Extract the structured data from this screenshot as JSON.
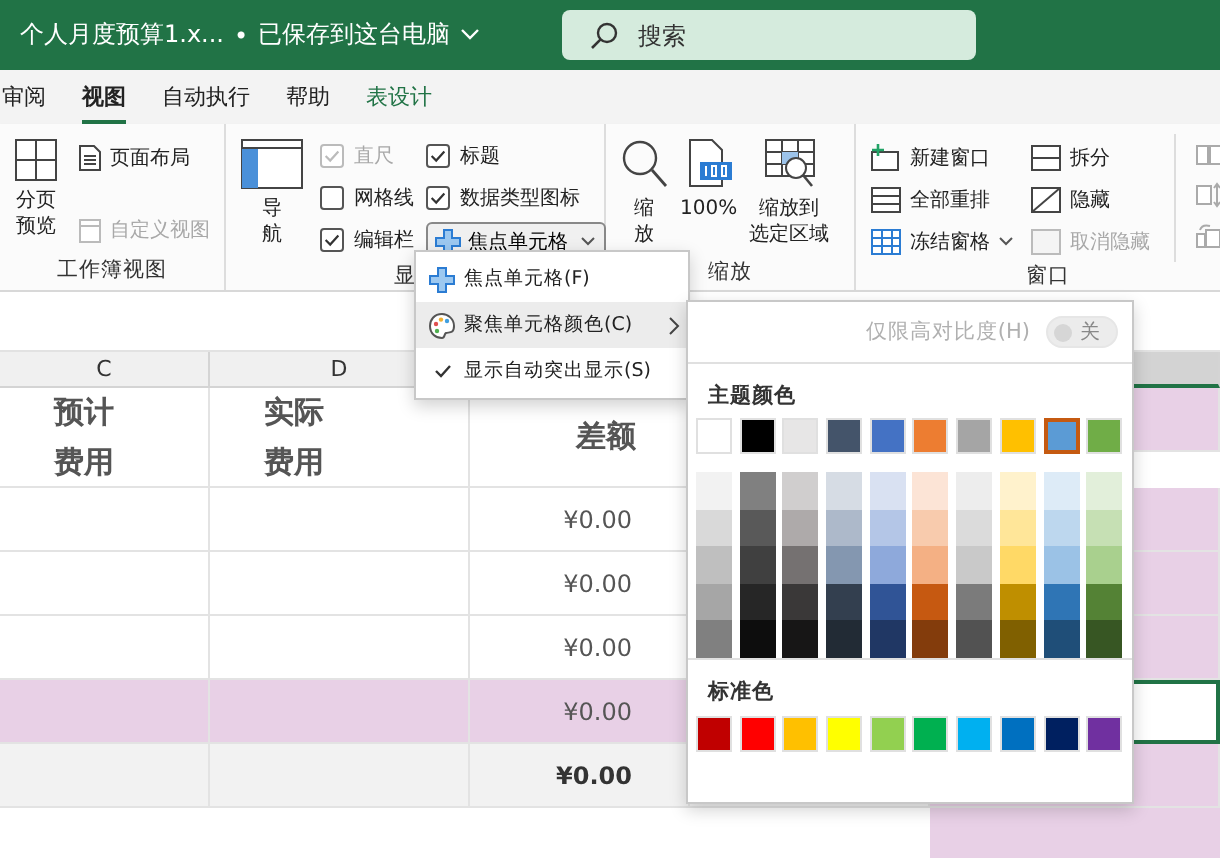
{
  "title_bar": {
    "document": "个人月度预算1.x...",
    "separator": "•",
    "save_status": "已保存到这台电脑",
    "search": {
      "placeholder": "搜索"
    }
  },
  "tabs": [
    {
      "label": "审阅",
      "selected": false,
      "kind": "normal"
    },
    {
      "label": "视图",
      "selected": true,
      "kind": "normal"
    },
    {
      "label": "自动执行",
      "selected": false,
      "kind": "normal"
    },
    {
      "label": "帮助",
      "selected": false,
      "kind": "normal"
    },
    {
      "label": "表设计",
      "selected": false,
      "kind": "contextual"
    }
  ],
  "ribbon": [
    {
      "label": "工作簿视图",
      "buttons": [
        {
          "label": "分页预览",
          "disabled": false
        },
        {
          "label": "页面布局",
          "disabled": false
        },
        {
          "label": "自定义视图",
          "disabled": true
        }
      ]
    },
    {
      "label": "显",
      "buttons": [
        {
          "label": "导航",
          "disabled": false
        }
      ],
      "checkboxes": [
        {
          "label": "直尺",
          "checked": true,
          "disabled": true
        },
        {
          "label": "网格线",
          "checked": false,
          "disabled": false
        },
        {
          "label": "编辑栏",
          "checked": true,
          "disabled": false
        },
        {
          "label": "标题",
          "checked": true,
          "disabled": false
        },
        {
          "label": "数据类型图标",
          "checked": true,
          "disabled": false
        }
      ],
      "dropdown": {
        "label": "焦点单元格",
        "expanded": true
      }
    },
    {
      "label": "缩放",
      "buttons": [
        {
          "label": "缩放",
          "disabled": false
        },
        {
          "label": "100%",
          "disabled": false
        },
        {
          "label": "缩放到选定区域",
          "disabled": false
        }
      ]
    },
    {
      "label": "窗口",
      "buttons": [
        {
          "label": "新建窗口",
          "disabled": false
        },
        {
          "label": "全部重排",
          "disabled": false
        },
        {
          "label": "冻结窗格",
          "disabled": false
        },
        {
          "label": "拆分",
          "disabled": false
        },
        {
          "label": "隐藏",
          "disabled": false
        },
        {
          "label": "取消隐藏",
          "disabled": true
        }
      ]
    }
  ],
  "sheet": {
    "columns": [
      "C",
      "D"
    ],
    "rows": [
      {
        "kind": "header",
        "c": "预计费用",
        "d": "实际费用",
        "e": "差额"
      },
      {
        "kind": "data",
        "e": "¥0.00"
      },
      {
        "kind": "data",
        "e": "¥0.00"
      },
      {
        "kind": "data",
        "e": "¥0.00"
      },
      {
        "kind": "focus",
        "e": "¥0.00"
      },
      {
        "kind": "total",
        "e": "¥0.00"
      }
    ]
  },
  "focus_menu": [
    {
      "label": "焦点单元格(F)",
      "kind": "command"
    },
    {
      "label": "聚焦单元格颜色(C)",
      "kind": "submenu",
      "expanded": true
    },
    {
      "label": "显示自动突出显示(S)",
      "kind": "toggle",
      "checked": true
    }
  ],
  "color_menu": {
    "high_contrast": {
      "label": "仅限高对比度(H)",
      "on": false,
      "disabled": true,
      "state_text": "关"
    },
    "theme_title": "主题颜色",
    "theme_colors": [
      {
        "color": "#ffffff",
        "selected": false,
        "shades": [
          {
            "color": "#f2f2f2"
          },
          {
            "color": "#d9d9d9"
          },
          {
            "color": "#bfbfbf"
          },
          {
            "color": "#a6a6a6"
          },
          {
            "color": "#808080"
          }
        ]
      },
      {
        "color": "#000000",
        "selected": false,
        "shades": [
          {
            "color": "#808080"
          },
          {
            "color": "#595959"
          },
          {
            "color": "#404040"
          },
          {
            "color": "#262626"
          },
          {
            "color": "#0d0d0d"
          }
        ]
      },
      {
        "color": "#e7e6e6",
        "selected": false,
        "shades": [
          {
            "color": "#d0cece"
          },
          {
            "color": "#aeaaaa"
          },
          {
            "color": "#757171"
          },
          {
            "color": "#3a3838"
          },
          {
            "color": "#171616"
          }
        ]
      },
      {
        "color": "#44546a",
        "selected": false,
        "shades": [
          {
            "color": "#d6dce4"
          },
          {
            "color": "#adb9ca"
          },
          {
            "color": "#8497b0"
          },
          {
            "color": "#333f4f"
          },
          {
            "color": "#222b35"
          }
        ]
      },
      {
        "color": "#4472c4",
        "selected": false,
        "shades": [
          {
            "color": "#d9e1f2"
          },
          {
            "color": "#b4c6e7"
          },
          {
            "color": "#8ea9db"
          },
          {
            "color": "#305496"
          },
          {
            "color": "#203764"
          }
        ]
      },
      {
        "color": "#ed7d31",
        "selected": false,
        "shades": [
          {
            "color": "#fce4d6"
          },
          {
            "color": "#f8cbad"
          },
          {
            "color": "#f4b084"
          },
          {
            "color": "#c65911"
          },
          {
            "color": "#833c0c"
          }
        ]
      },
      {
        "color": "#a5a5a5",
        "selected": false,
        "shades": [
          {
            "color": "#ededed"
          },
          {
            "color": "#dbdbdb"
          },
          {
            "color": "#c9c9c9"
          },
          {
            "color": "#7b7b7b"
          },
          {
            "color": "#525252"
          }
        ]
      },
      {
        "color": "#ffc000",
        "selected": false,
        "shades": [
          {
            "color": "#fff2cc"
          },
          {
            "color": "#ffe699"
          },
          {
            "color": "#ffd966"
          },
          {
            "color": "#bf8f00"
          },
          {
            "color": "#806000"
          }
        ]
      },
      {
        "color": "#5b9bd5",
        "selected": true,
        "shades": [
          {
            "color": "#ddebf7"
          },
          {
            "color": "#bdd7ee"
          },
          {
            "color": "#9bc2e6"
          },
          {
            "color": "#2f75b5"
          },
          {
            "color": "#1f4e78"
          }
        ]
      },
      {
        "color": "#70ad47",
        "selected": false,
        "shades": [
          {
            "color": "#e2efda"
          },
          {
            "color": "#c6e0b4"
          },
          {
            "color": "#a9d08e"
          },
          {
            "color": "#548235"
          },
          {
            "color": "#375623"
          }
        ]
      }
    ],
    "standard_title": "标准色",
    "standard_colors": [
      {
        "color": "#c00000"
      },
      {
        "color": "#ff0000"
      },
      {
        "color": "#ffc000"
      },
      {
        "color": "#ffff00"
      },
      {
        "color": "#92d050"
      },
      {
        "color": "#00b050"
      },
      {
        "color": "#00b0f0"
      },
      {
        "color": "#0070c0"
      },
      {
        "color": "#002060"
      },
      {
        "color": "#7030a0"
      }
    ]
  }
}
